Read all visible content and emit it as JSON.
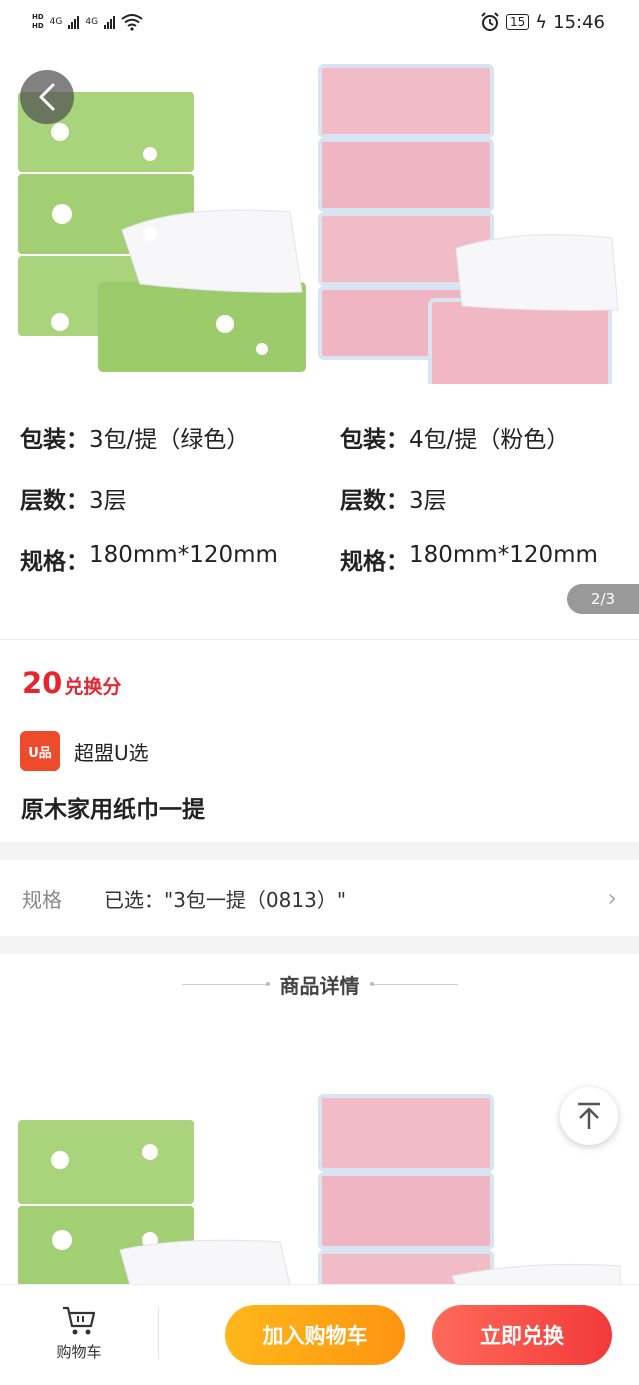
{
  "status_bar": {
    "network_1": "4G",
    "network_2": "4G",
    "battery": "15",
    "time": "15:46"
  },
  "gallery": {
    "pager": "2/3",
    "left_product": {
      "package_label": "包装：",
      "package_value": "3包/提（绿色）",
      "layers_label": "层数：",
      "layers_value": "3层",
      "size_label": "规格：",
      "size_value": "180mm*120mm"
    },
    "right_product": {
      "package_label": "包装：",
      "package_value": "4包/提（粉色）",
      "layers_label": "层数：",
      "layers_value": "3层",
      "size_label": "规格：",
      "size_value": "180mm*120mm"
    },
    "colors": {
      "green": "#a6d27a",
      "pink": "#f0b7c3"
    }
  },
  "product": {
    "points_value": "20",
    "points_unit": "兑换分",
    "store_logo": "U品",
    "store_name": "超盟U选",
    "title": "原木家用纸巾一提"
  },
  "spec_select": {
    "label": "规格",
    "value": "已选：\"3包一提（0813）\""
  },
  "detail": {
    "heading": "商品详情"
  },
  "bottom_bar": {
    "cart_label": "购物车",
    "add_to_cart": "加入购物车",
    "redeem_now": "立即兑换"
  },
  "icons": [
    "back-arrow-icon",
    "back-to-top-icon",
    "cart-icon",
    "alarm-icon",
    "wifi-icon"
  ]
}
